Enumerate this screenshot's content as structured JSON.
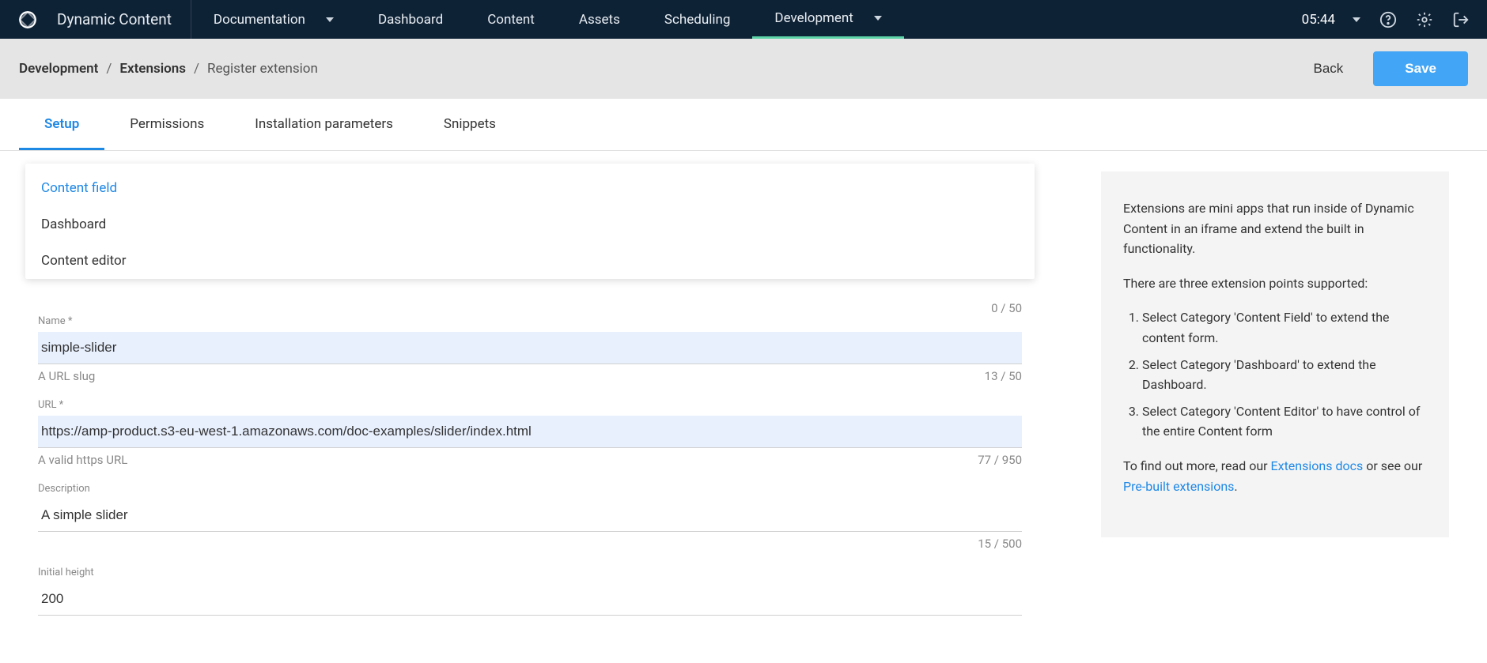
{
  "brand": "Dynamic Content",
  "nav": {
    "documentation": "Documentation",
    "dashboard": "Dashboard",
    "content": "Content",
    "assets": "Assets",
    "scheduling": "Scheduling",
    "development": "Development"
  },
  "time": "05:44",
  "breadcrumb": {
    "part1": "Development",
    "part2": "Extensions",
    "part3": "Register extension"
  },
  "actions": {
    "back": "Back",
    "save": "Save"
  },
  "tabs": {
    "setup": "Setup",
    "permissions": "Permissions",
    "install": "Installation parameters",
    "snippets": "Snippets"
  },
  "dropdown": {
    "opt1": "Content field",
    "opt2": "Dashboard",
    "opt3": "Content editor"
  },
  "form": {
    "label_counter": "0 / 50",
    "name_label": "Name *",
    "name_value": "simple-slider",
    "name_hint": "A URL slug",
    "name_counter": "13 / 50",
    "url_label": "URL *",
    "url_value": "https://amp-product.s3-eu-west-1.amazonaws.com/doc-examples/slider/index.html",
    "url_hint": "A valid https URL",
    "url_counter": "77 / 950",
    "desc_label": "Description",
    "desc_value": "A simple slider",
    "desc_counter": "15 / 500",
    "height_label": "Initial height",
    "height_value": "200"
  },
  "info": {
    "p1": "Extensions are mini apps that run inside of Dynamic Content in an iframe and extend the built in functionality.",
    "p2": "There are three extension points supported:",
    "li1": "Select Category 'Content Field' to extend the content form.",
    "li2": "Select Category 'Dashboard' to extend the Dashboard.",
    "li3": "Select Category 'Content Editor' to have control of the entire Content form",
    "p3a": "To find out more, read our ",
    "link1": "Extensions docs",
    "p3b": " or see our ",
    "link2": "Pre-built extensions",
    "p3c": "."
  }
}
